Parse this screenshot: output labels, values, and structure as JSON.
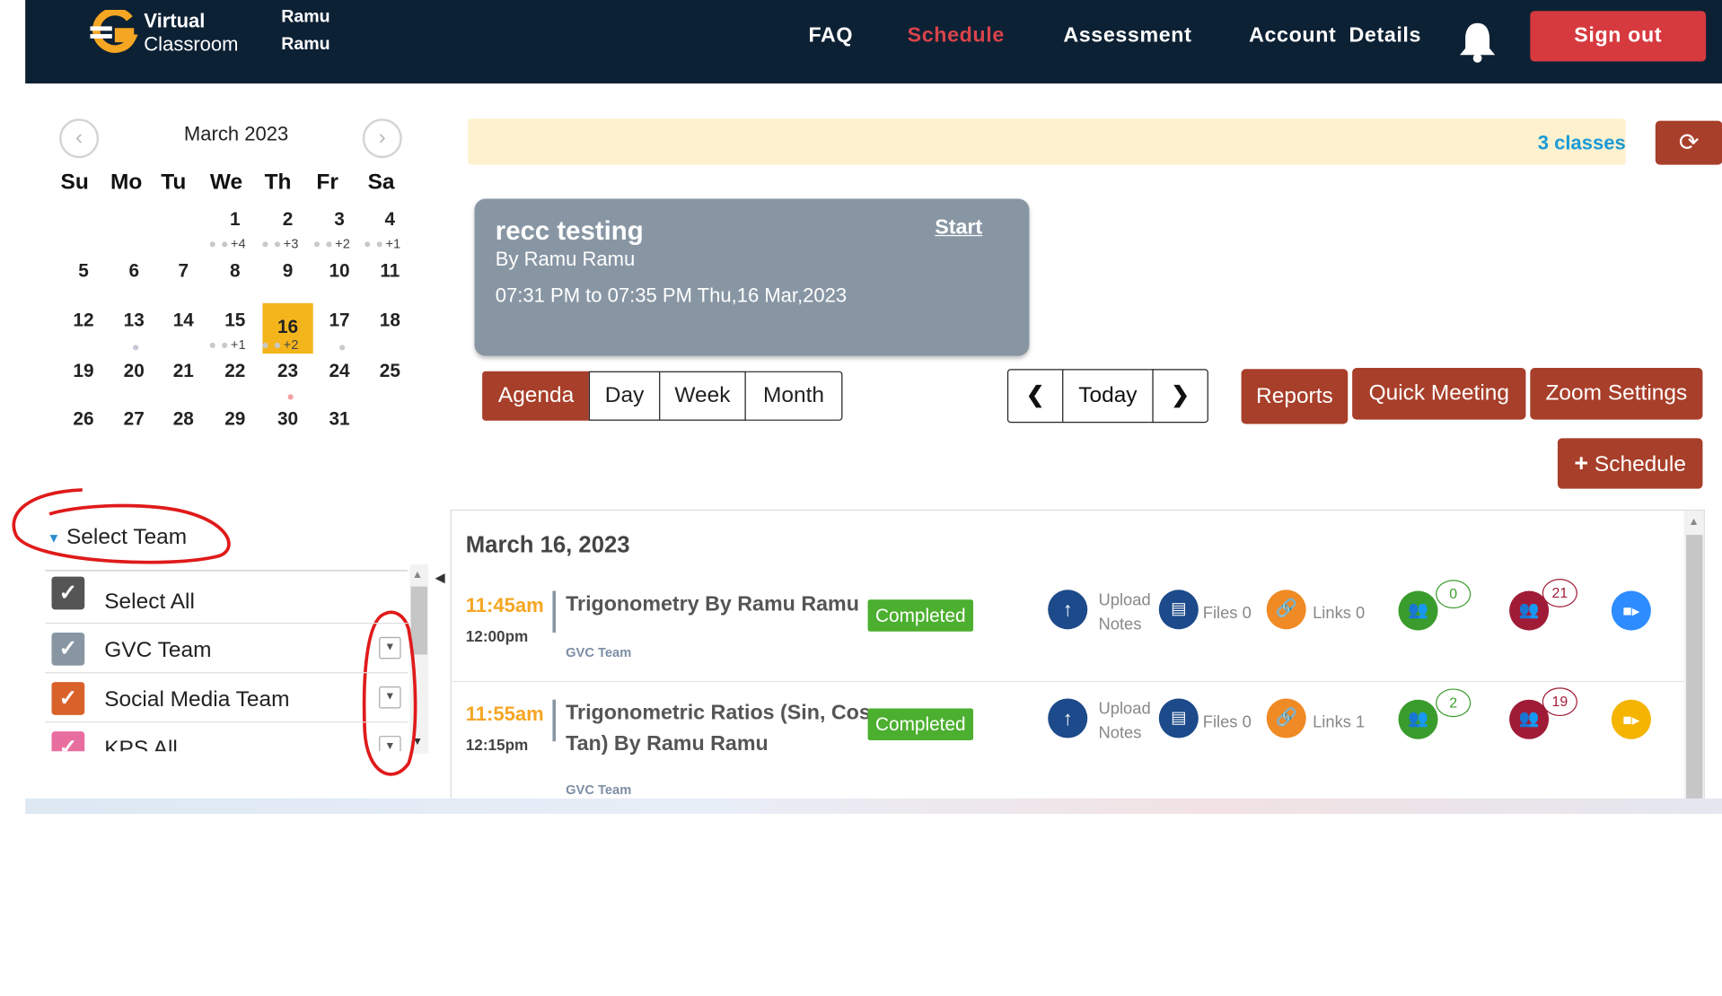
{
  "header": {
    "logo_line1": "Virtual",
    "logo_line2": "Classroom",
    "user_first": "Ramu",
    "user_last": "Ramu",
    "nav": [
      "FAQ",
      "Schedule",
      "Assessment",
      "Account  Details"
    ],
    "active_nav": "Schedule",
    "sign_out": "Sign out"
  },
  "calendar": {
    "title": "March 2023",
    "days_of_week": [
      "Su",
      "Mo",
      "Tu",
      "We",
      "Th",
      "Fr",
      "Sa"
    ],
    "weeks": [
      [
        "",
        "",
        "",
        "1",
        "2",
        "3",
        "4"
      ],
      [
        "5",
        "6",
        "7",
        "8",
        "9",
        "10",
        "11"
      ],
      [
        "12",
        "13",
        "14",
        "15",
        "16",
        "17",
        "18"
      ],
      [
        "19",
        "20",
        "21",
        "22",
        "23",
        "24",
        "25"
      ],
      [
        "26",
        "27",
        "28",
        "29",
        "30",
        "31",
        ""
      ]
    ],
    "selected_day": "16",
    "more_counts": {
      "1": "+4",
      "2": "+3",
      "3": "+2",
      "4": "+1",
      "15": "+1",
      "16": "+2"
    }
  },
  "teams": {
    "header": "Select Team",
    "items": [
      {
        "label": "Select All",
        "color": "#555555"
      },
      {
        "label": "GVC Team",
        "color": "#8896a4"
      },
      {
        "label": "Social Media Team",
        "color": "#d9622b"
      },
      {
        "label": "KPS All",
        "color": "#e86ea0"
      }
    ]
  },
  "banner": {
    "text": "3 classes"
  },
  "class_card": {
    "title": "recc testing",
    "start": "Start",
    "by": "By Ramu Ramu",
    "time": "07:31 PM to 07:35 PM Thu,16 Mar,2023"
  },
  "views": [
    "Agenda",
    "Day",
    "Week",
    "Month"
  ],
  "active_view": "Agenda",
  "nav_today": "Today",
  "actions": {
    "reports": "Reports",
    "quick_meeting": "Quick Meeting",
    "zoom_settings": "Zoom Settings",
    "schedule": "Schedule"
  },
  "agenda": {
    "date": "March 16, 2023",
    "events": [
      {
        "start": "11:45am",
        "end": "12:00pm",
        "title_line1": "Trigonometry By Ramu Ramu",
        "title_line2": "",
        "team": "GVC Team",
        "status": "Completed",
        "upload_line1": "Upload",
        "upload_line2": "Notes",
        "files": "Files 0",
        "links": "Links 0",
        "present": "0",
        "absent": "21",
        "meeting_icon": "zoom-video-icon"
      },
      {
        "start": "11:55am",
        "end": "12:15pm",
        "title_line1": "Trigonometric Ratios (Sin, Cos,",
        "title_line2": "Tan) By Ramu Ramu",
        "team": "GVC Team",
        "status": "Completed",
        "upload_line1": "Upload",
        "upload_line2": "Notes",
        "files": "Files 0",
        "links": "Links 1",
        "present": "2",
        "absent": "19",
        "meeting_icon": "video-camera-icon"
      }
    ]
  }
}
